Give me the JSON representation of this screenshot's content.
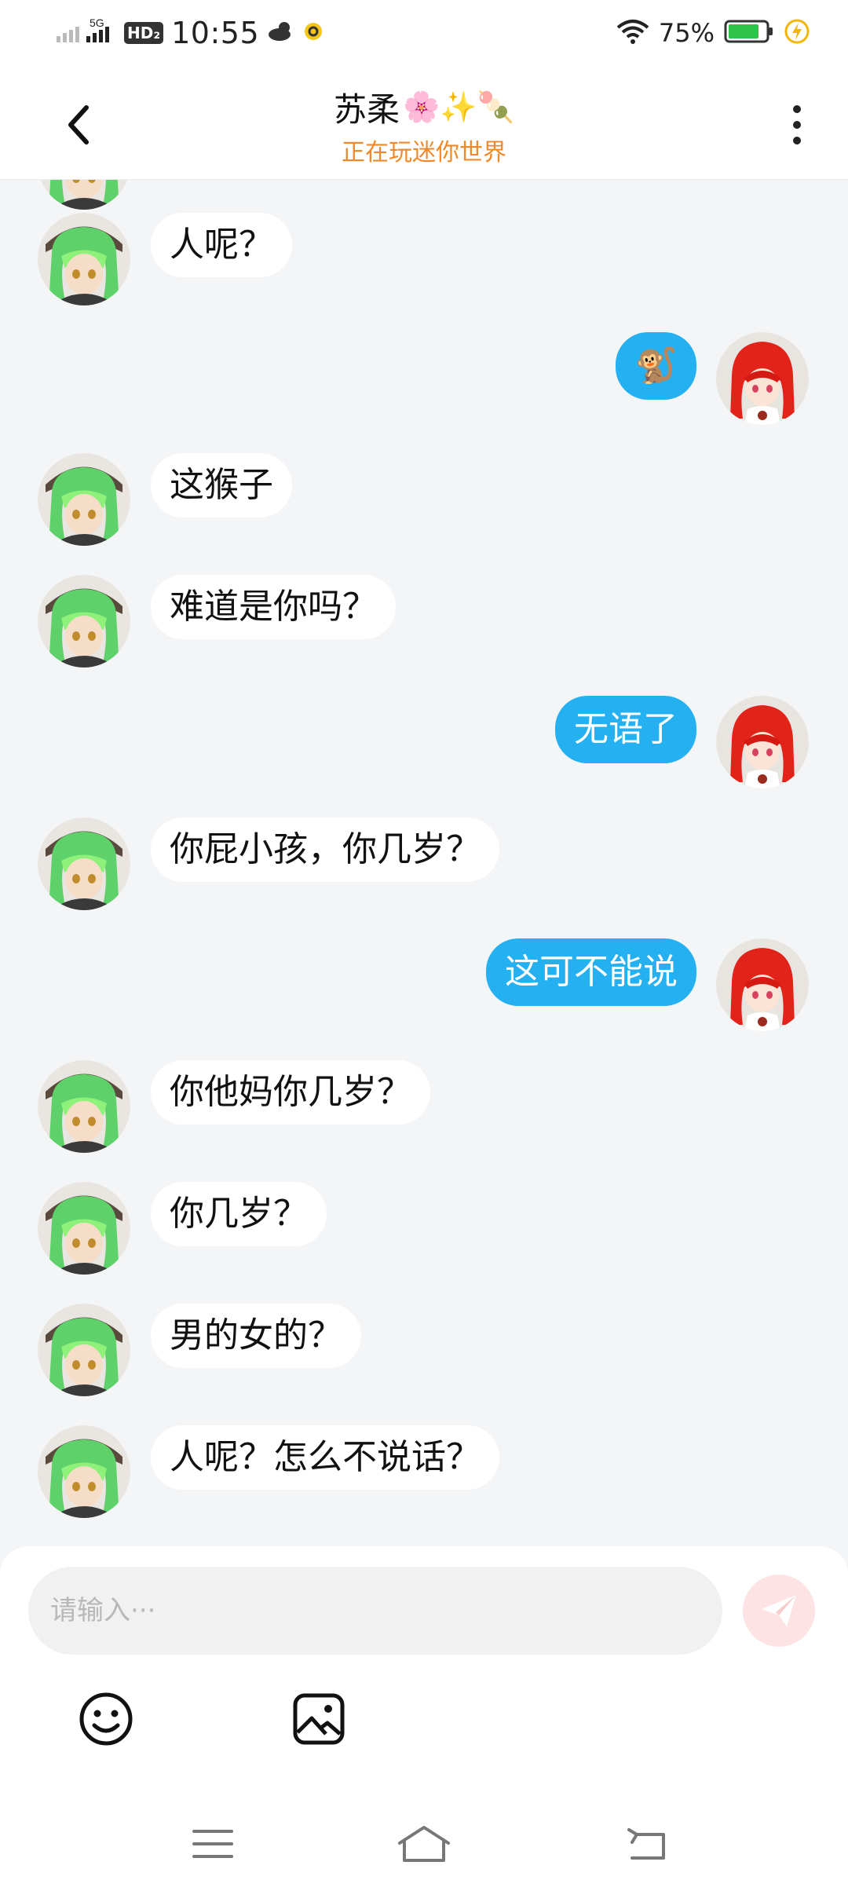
{
  "status_bar": {
    "network": "5G",
    "hd": "HD₂",
    "time": "10:55",
    "battery": "75%"
  },
  "header": {
    "title": "苏柔",
    "title_emojis": "🌸✨🍡",
    "subtitle": "正在玩迷你世界"
  },
  "messages": [
    {
      "side": "left",
      "text": "人呢？"
    },
    {
      "side": "right",
      "text": "🐒"
    },
    {
      "side": "left",
      "text": "这猴子"
    },
    {
      "side": "left",
      "text": "难道是你吗？"
    },
    {
      "side": "right",
      "text": "无语了"
    },
    {
      "side": "left",
      "text": "你屁小孩，你几岁？"
    },
    {
      "side": "right",
      "text": "这可不能说"
    },
    {
      "side": "left",
      "text": "你他妈你几岁？"
    },
    {
      "side": "left",
      "text": "你几岁？"
    },
    {
      "side": "left",
      "text": "男的女的？"
    },
    {
      "side": "left",
      "text": "人呢？怎么不说话？"
    }
  ],
  "composer": {
    "placeholder": "请输入···"
  },
  "colors": {
    "accent_blue": "#25b0f2",
    "subtitle_orange": "#ef8a2c",
    "background": "#f4f5f7"
  }
}
